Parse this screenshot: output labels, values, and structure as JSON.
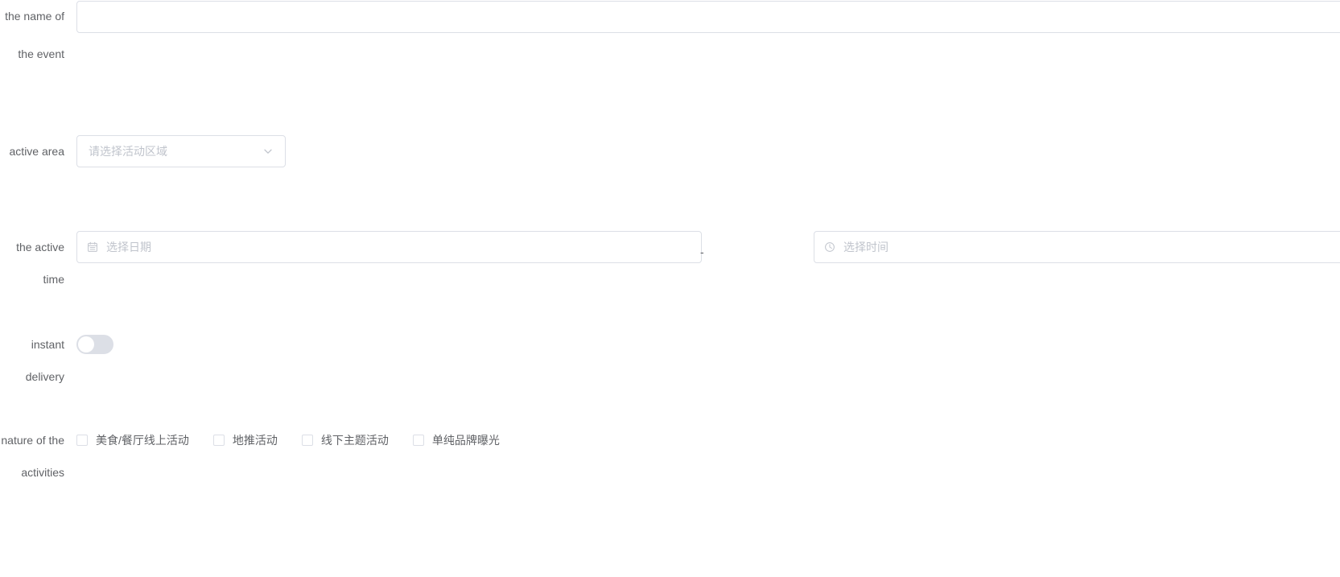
{
  "form": {
    "items": [
      {
        "label": "the name of the event",
        "type": "input",
        "value": "",
        "placeholder": ""
      },
      {
        "label": "active area",
        "type": "select",
        "value": "",
        "placeholder": "请选择活动区域",
        "icon": "chevron-down-icon"
      },
      {
        "label": "the active time",
        "type": "datetime-range",
        "date": {
          "value": "",
          "placeholder": "选择日期",
          "icon": "calendar-icon"
        },
        "separator": "-",
        "time": {
          "value": "",
          "placeholder": "选择时间",
          "icon": "clock-icon"
        }
      },
      {
        "label": "instant delivery",
        "type": "switch",
        "checked": false
      },
      {
        "label": "nature of the activities",
        "type": "checkbox-group",
        "options": [
          {
            "label": "美食/餐厅线上活动",
            "checked": false
          },
          {
            "label": "地推活动",
            "checked": false
          },
          {
            "label": "线下主题活动",
            "checked": false
          },
          {
            "label": "单纯品牌曝光",
            "checked": false
          }
        ]
      }
    ]
  },
  "colors": {
    "border": "#dcdfe6",
    "placeholder": "#c0c4cc",
    "label": "#606266",
    "switch_off": "#dcdfe6",
    "background": "#ffffff"
  }
}
